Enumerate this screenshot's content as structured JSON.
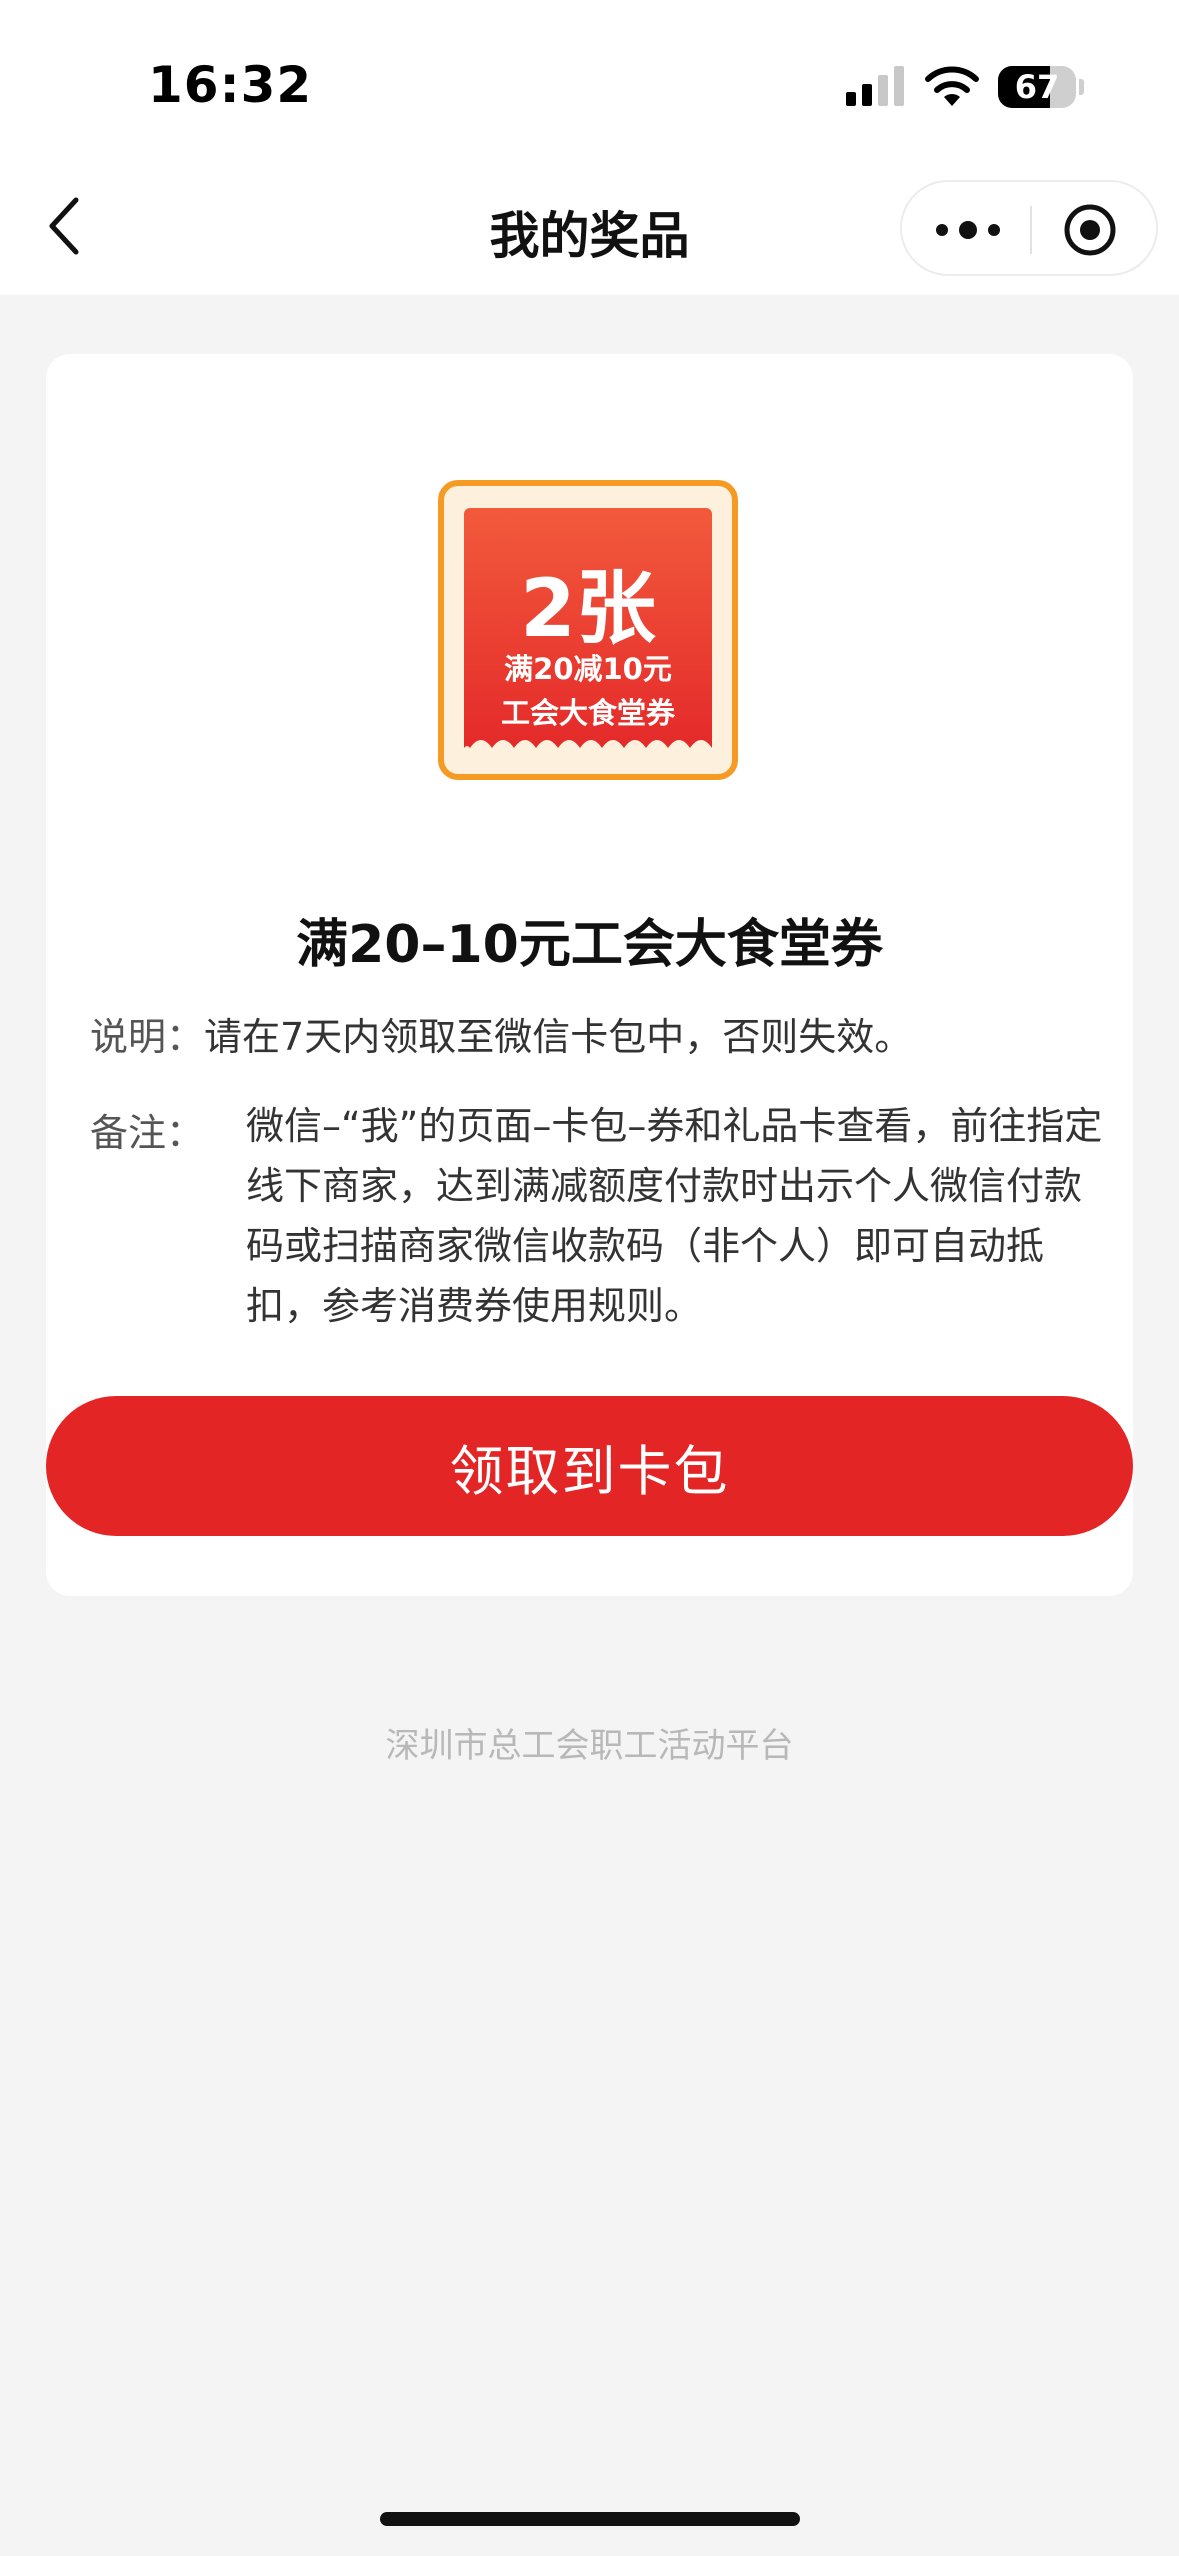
{
  "status_bar": {
    "time": "16:32",
    "battery_level": "67",
    "battery_fraction": 0.67,
    "icons": [
      "signal-icon",
      "wifi-icon",
      "battery-icon"
    ]
  },
  "nav": {
    "title": "我的奖品",
    "icons": [
      "chevron-left-icon",
      "more-dots-icon",
      "target-icon"
    ]
  },
  "coupon": {
    "count": "2张",
    "line1": "满20减10元",
    "line2": "工会大食堂券",
    "colors": {
      "border": "#f59a23",
      "fill_top": "#f25a3c",
      "fill_bottom": "#e42a2a",
      "background": "#fdf0dc"
    }
  },
  "prize": {
    "title": "满20–10元工会大食堂券",
    "desc_label": "说明：",
    "desc_text": "请在7天内领取至微信卡包中，否则失效。",
    "remark_label": "备注：",
    "remark_text": "微信–“我”的页面–卡包–券和礼品卡查看，前往指定线下商家，达到满减额度付款时出示个人微信付款码或扫描商家微信收款码（非个人）即可自动抵扣，参考消费券使用规则。"
  },
  "actions": {
    "claim_label": "领取到卡包",
    "claim_color": "#e32526"
  },
  "footer": {
    "text": "深圳市总工会职工活动平台"
  }
}
